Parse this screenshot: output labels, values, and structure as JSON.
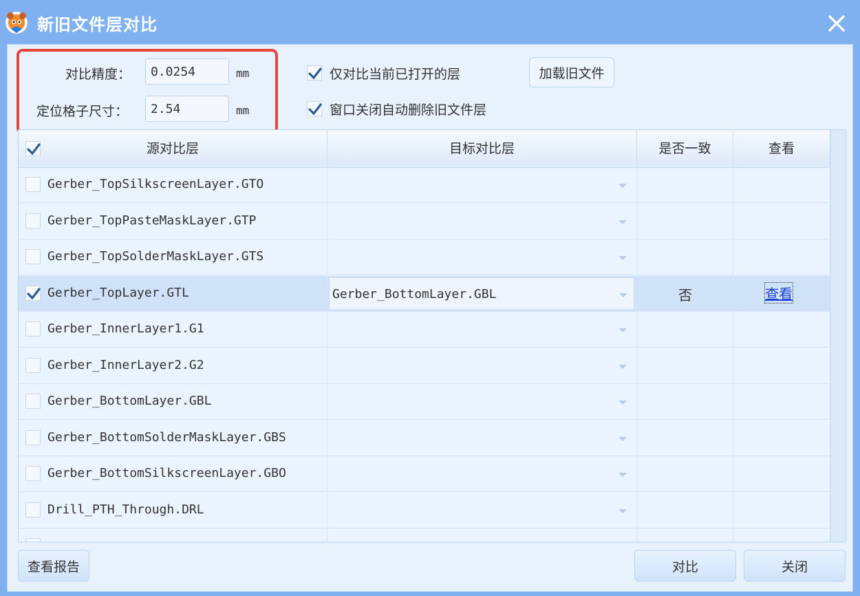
{
  "window": {
    "title": "新旧文件层对比"
  },
  "settings": {
    "precision_label": "对比精度：",
    "precision_value": "0.0254",
    "precision_unit": "mm",
    "grid_label": "定位格子尺寸：",
    "grid_value": "2.54",
    "grid_unit": "mm",
    "only_open_label": "仅对比当前已打开的层",
    "only_open_checked": true,
    "auto_delete_label": "窗口关闭自动删除旧文件层",
    "auto_delete_checked": true,
    "load_old_button": "加载旧文件"
  },
  "table": {
    "columns": [
      "源对比层",
      "目标对比层",
      "是否一致",
      "查看"
    ],
    "header_checked": true,
    "rows": [
      {
        "checked": false,
        "source": "Gerber_TopSilkscreenLayer.GTO",
        "target": "",
        "match": "",
        "view": ""
      },
      {
        "checked": false,
        "source": "Gerber_TopPasteMaskLayer.GTP",
        "target": "",
        "match": "",
        "view": ""
      },
      {
        "checked": false,
        "source": "Gerber_TopSolderMaskLayer.GTS",
        "target": "",
        "match": "",
        "view": ""
      },
      {
        "checked": true,
        "source": "Gerber_TopLayer.GTL",
        "target": "Gerber_BottomLayer.GBL",
        "match": "否",
        "view": "查看"
      },
      {
        "checked": false,
        "source": "Gerber_InnerLayer1.G1",
        "target": "",
        "match": "",
        "view": ""
      },
      {
        "checked": false,
        "source": "Gerber_InnerLayer2.G2",
        "target": "",
        "match": "",
        "view": ""
      },
      {
        "checked": false,
        "source": "Gerber_BottomLayer.GBL",
        "target": "",
        "match": "",
        "view": ""
      },
      {
        "checked": false,
        "source": "Gerber_BottomSolderMaskLayer.GBS",
        "target": "",
        "match": "",
        "view": ""
      },
      {
        "checked": false,
        "source": "Gerber_BottomSilkscreenLayer.GBO",
        "target": "",
        "match": "",
        "view": ""
      },
      {
        "checked": false,
        "source": "Drill_PTH_Through.DRL",
        "target": "",
        "match": "",
        "view": ""
      }
    ]
  },
  "footer": {
    "report_button": "查看报告",
    "compare_button": "对比",
    "close_button": "关闭"
  },
  "colors": {
    "titlebar": "#7fb0ef",
    "client": "#e8f2fd",
    "highlight": "#e8443a",
    "check": "#2d5b8c",
    "link": "#1a3fd6"
  }
}
